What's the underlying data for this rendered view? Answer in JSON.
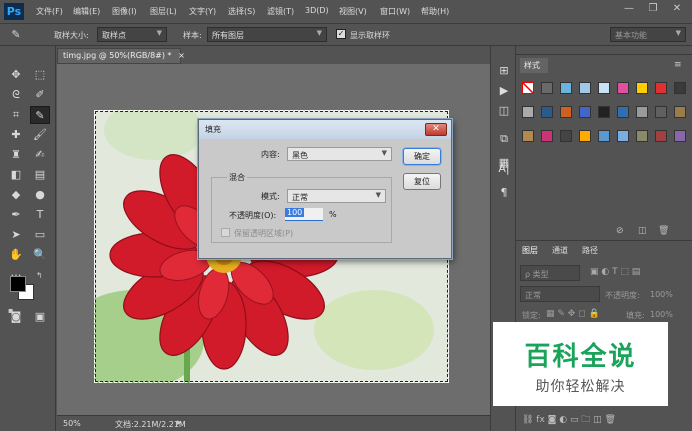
{
  "app": {
    "logo": "Ps"
  },
  "menu": [
    "文件(F)",
    "编辑(E)",
    "图像(I)",
    "图层(L)",
    "文字(Y)",
    "选择(S)",
    "滤镜(T)",
    "3D(D)",
    "视图(V)",
    "窗口(W)",
    "帮助(H)"
  ],
  "window_controls": {
    "minimize": "—",
    "restore": "❐",
    "close": "✕"
  },
  "options": {
    "sample_size_label": "取样大小:",
    "sample_size_value": "取样点",
    "sample_label": "样本:",
    "sample_value": "所有图层",
    "show_ring_label": "显示取样环",
    "workspace": "基本功能"
  },
  "document": {
    "tab_title": "timg.jpg @ 50%(RGB/8#) *",
    "close": "×",
    "zoom": "50%",
    "doc_info": "文档:2.21M/2.21M"
  },
  "dialog": {
    "title": "填充",
    "content_label": "内容:",
    "content_value": "黑色",
    "blend_group": "混合",
    "mode_label": "模式:",
    "mode_value": "正常",
    "opacity_label": "不透明度(O):",
    "opacity_value": "100",
    "opacity_unit": "%",
    "preserve_label": "保留透明区域(P)",
    "ok": "确定",
    "reset": "复位"
  },
  "swatches_panel": {
    "tab": "样式",
    "colors": [
      "#ffffff",
      "#6a6a6a",
      "#6ab4e0",
      "#a0c8e8",
      "#c8e4f4",
      "#e050a0",
      "#ffcc00",
      "#e03030",
      "#3a3a3a",
      "#aaaaaa",
      "#2a5a8a",
      "#d06020",
      "#4466cc",
      "#222222",
      "#2f6fb0",
      "#9a9a9a",
      "#606060",
      "#9a7b4a",
      "#b08a50",
      "#cc3377",
      "#444444",
      "#ffaa00",
      "#5a9ad0",
      "#7aaee0",
      "#8a8a6a",
      "#a04040",
      "#8866aa"
    ]
  },
  "layers_panel": {
    "tabs": [
      "图层",
      "通道",
      "路径"
    ],
    "kind_label": "ρ 类型",
    "blend_mode": "正常",
    "opacity_label": "不透明度:",
    "opacity_value": "100%",
    "lock_label": "锁定:",
    "fill_label": "填充:",
    "fill_value": "100%"
  },
  "watermark": {
    "title": "百科全说",
    "subtitle": "助你轻松解决"
  }
}
